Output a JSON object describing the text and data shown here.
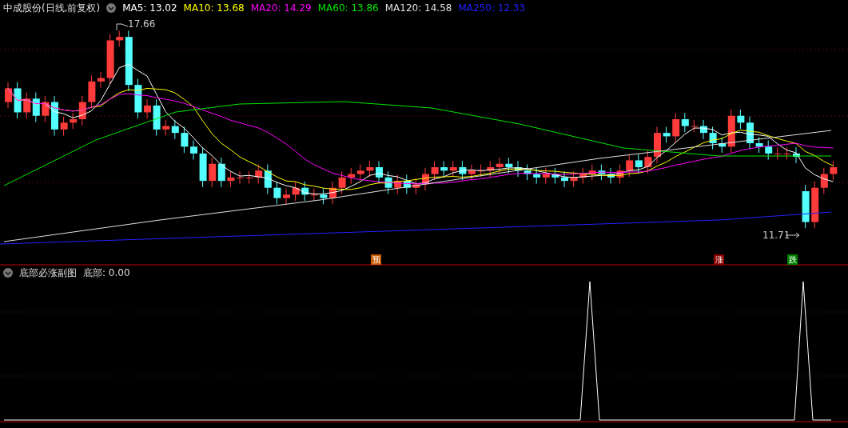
{
  "header": {
    "title": "中成股份(日线,前复权)"
  },
  "ma_legend": [
    {
      "label": "MA5: 13.02",
      "color": "#ffffff"
    },
    {
      "label": "MA10: 13.68",
      "color": "#ffff00"
    },
    {
      "label": "MA20: 14.29",
      "color": "#ff00ff"
    },
    {
      "label": "MA60: 13.86",
      "color": "#00e600"
    },
    {
      "label": "MA120: 14.58",
      "color": "#e0e0e0"
    },
    {
      "label": "MA250: 12.33",
      "color": "#2020ff"
    }
  ],
  "price_labels": {
    "high": "17.66",
    "low": "11.71"
  },
  "signal_markers": [
    {
      "text": "预",
      "color": "#c85a00"
    },
    {
      "text": "涨",
      "color": "#8b0000"
    },
    {
      "text": "跌",
      "color": "#008000"
    }
  ],
  "sub_chart": {
    "title": "底部必涨副图",
    "reading": "底部: 0.00"
  }
}
